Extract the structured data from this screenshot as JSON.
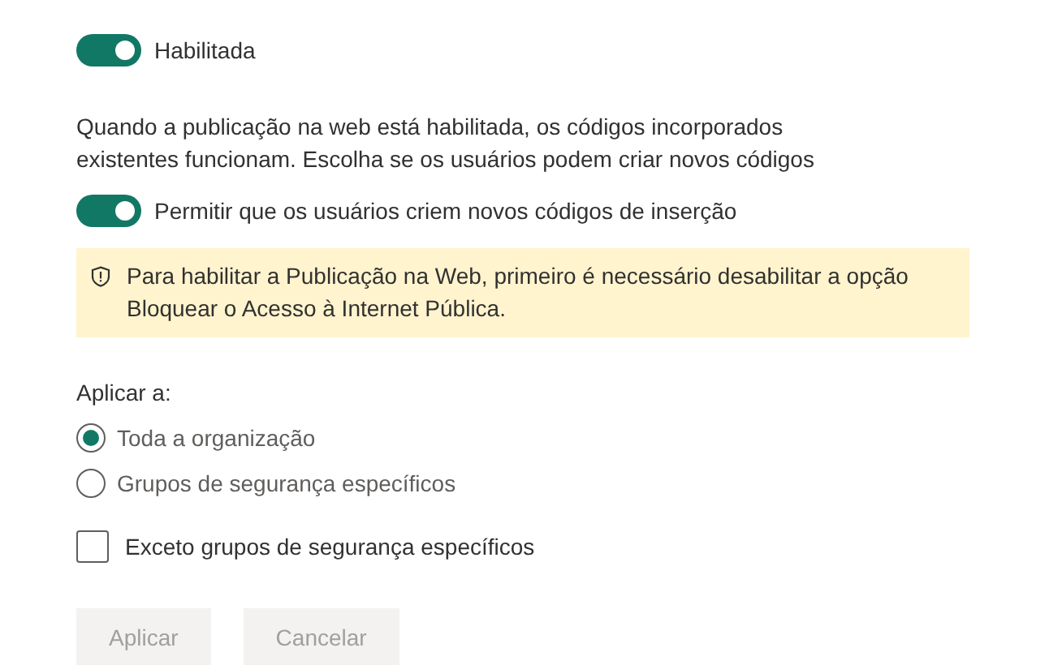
{
  "main_toggle": {
    "label": "Habilitada",
    "on": true
  },
  "description": "Quando a publicação na web está habilitada, os códigos incorporados existentes funcionam. Escolha se os usuários podem criar novos códigos",
  "embed_toggle": {
    "label": "Permitir que os usuários criem novos códigos de inserção",
    "on": true
  },
  "warning": {
    "text": "Para habilitar a Publicação na Web, primeiro é necessário desabilitar a opção Bloquear o Acesso à Internet Pública."
  },
  "apply_to": {
    "label": "Aplicar a:",
    "options": [
      {
        "label": "Toda a organização",
        "selected": true
      },
      {
        "label": "Grupos de segurança específicos",
        "selected": false
      }
    ]
  },
  "except_checkbox": {
    "label": "Exceto grupos de segurança específicos",
    "checked": false
  },
  "buttons": [
    {
      "label": "Aplicar",
      "disabled": true
    },
    {
      "label": "Cancelar",
      "disabled": true
    }
  ]
}
